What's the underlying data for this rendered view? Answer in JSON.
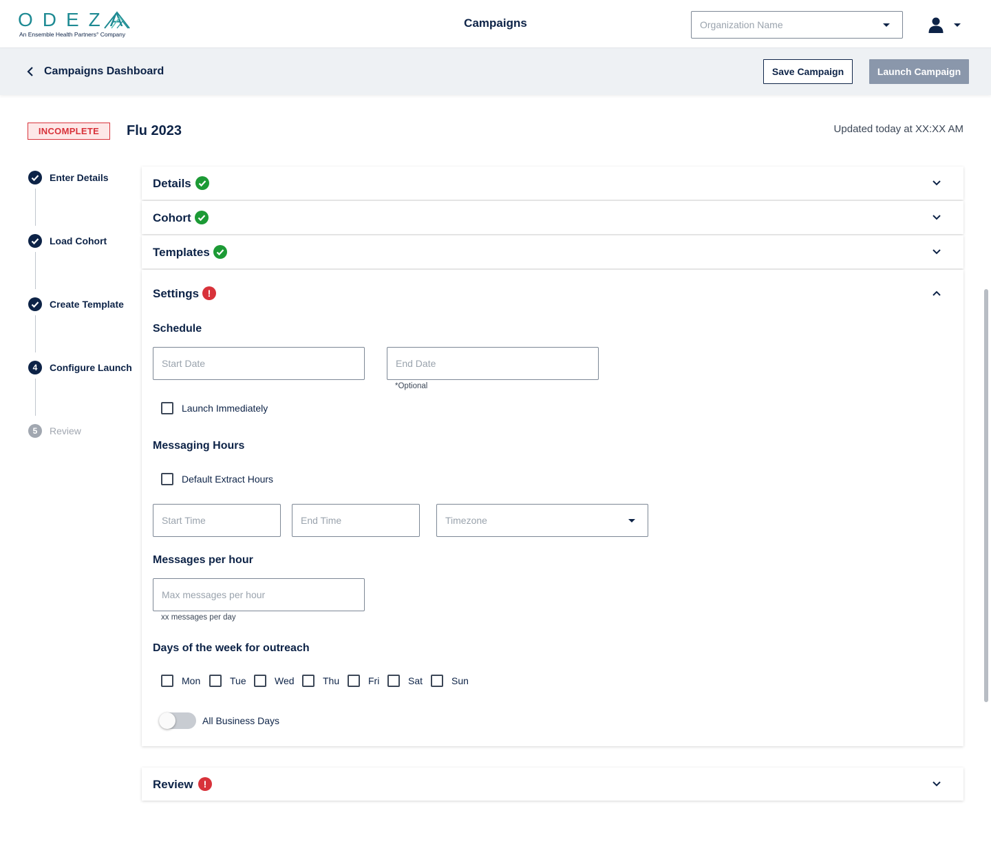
{
  "app": {
    "logo_text": "ODEZA",
    "logo_tagline": "An Ensemble Health Partners° Company",
    "page_title": "Campaigns",
    "org_select_placeholder": "Organization Name",
    "user_icon": "user-icon"
  },
  "subheader": {
    "breadcrumb": "Campaigns Dashboard",
    "save_label": "Save Campaign",
    "launch_label": "Launch Campaign"
  },
  "campaign": {
    "status": "INCOMPLETE",
    "name": "Flu 2023",
    "updated": "Updated today at XX:XX AM"
  },
  "stepper": [
    {
      "label": "Enter Details",
      "state": "complete"
    },
    {
      "label": "Load Cohort",
      "state": "complete"
    },
    {
      "label": "Create Template",
      "state": "complete"
    },
    {
      "number": "4",
      "label": "Configure Launch",
      "state": "active"
    },
    {
      "number": "5",
      "label": "Review",
      "state": "pending"
    }
  ],
  "sections": {
    "details": "Details",
    "cohort": "Cohort",
    "templates": "Templates",
    "settings": "Settings",
    "review": "Review",
    "error_mark": "!"
  },
  "settings": {
    "schedule_label": "Schedule",
    "start_date_placeholder": "Start Date",
    "end_date_placeholder": "End Date",
    "end_date_hint": "*Optional",
    "launch_immediately": "Launch Immediately",
    "messaging_hours_label": "Messaging Hours",
    "default_extract_hours": "Default Extract Hours",
    "start_time_placeholder": "Start Time",
    "end_time_placeholder": "End Time",
    "timezone_placeholder": "Timezone",
    "messages_per_hour_label": "Messages per hour",
    "max_messages_placeholder": "Max messages per hour",
    "messages_per_day_hint": "xx messages per day",
    "days_label": "Days of the week for outreach",
    "days": [
      "Mon",
      "Tue",
      "Wed",
      "Thu",
      "Fri",
      "Sat",
      "Sun"
    ],
    "all_business_days": "All Business Days"
  },
  "colors": {
    "navy": "#0d2347",
    "teal": "#1e8a93",
    "success": "#1c9a35",
    "error": "#d8323a",
    "disabled_button": "#8a97ab"
  }
}
